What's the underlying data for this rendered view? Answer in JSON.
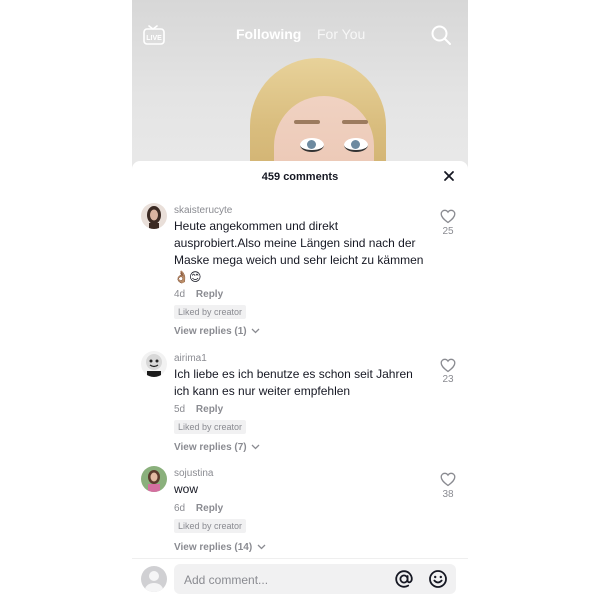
{
  "header": {
    "tab_following": "Following",
    "tab_for_you": "For You",
    "live_label": "LIVE"
  },
  "comments_panel": {
    "title": "459 comments",
    "comments": [
      {
        "username": "skaisterucyte",
        "text": "Heute angekommen und direkt ausprobiert.Also meine Längen sind nach der Maske mega weich und sehr leicht zu kämmen 👌🏽😊",
        "age": "4d",
        "reply_label": "Reply",
        "liked_badge": "Liked by creator",
        "view_replies": "View replies (1)",
        "likes": "25"
      },
      {
        "username": "airima1",
        "text": "Ich liebe es ich benutze es schon seit Jahren ich kann es nur weiter empfehlen",
        "age": "5d",
        "reply_label": "Reply",
        "liked_badge": "Liked by creator",
        "view_replies": "View replies (7)",
        "likes": "23"
      },
      {
        "username": "sojustina",
        "text": "wow",
        "age": "6d",
        "reply_label": "Reply",
        "liked_badge": "Liked by creator",
        "view_replies": "View replies (14)",
        "likes": "38"
      }
    ]
  },
  "composer": {
    "placeholder": "Add comment..."
  },
  "colors": {
    "text_primary": "#161823",
    "text_secondary": "#8a8b91",
    "badge_bg": "#f1f1f2"
  },
  "icons": {
    "live": "live-tv-icon",
    "search": "search-icon",
    "close": "close-icon",
    "heart": "heart-outline-icon",
    "chevron": "chevron-down-icon",
    "mention": "at-sign-icon",
    "emoji": "smiley-icon"
  }
}
